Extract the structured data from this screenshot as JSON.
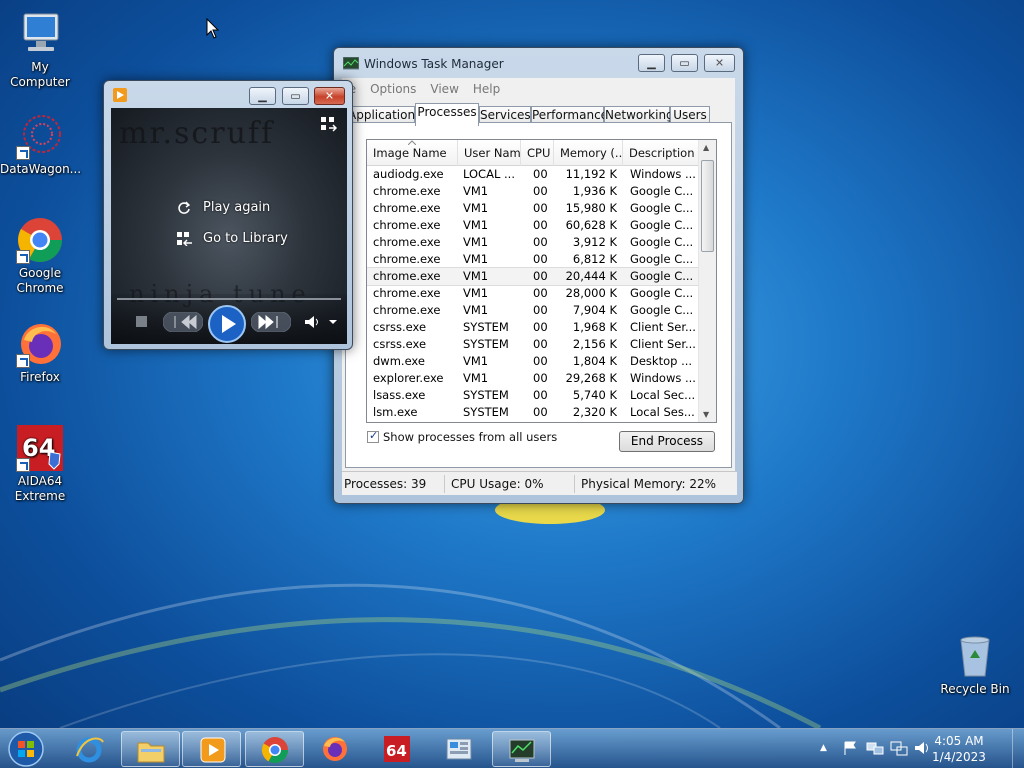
{
  "desktop": {
    "icons": [
      {
        "label": "My Computer"
      },
      {
        "label": "DataWagon..."
      },
      {
        "label": "Google Chrome"
      },
      {
        "label": "Firefox"
      },
      {
        "label": "AIDA64 Extreme"
      },
      {
        "label": "Recycle Bin"
      }
    ]
  },
  "media_player": {
    "play_again": "Play again",
    "go_to_library": "Go to Library",
    "art_title": "mr.scruff",
    "art_subtitle": "ninja tune"
  },
  "task_manager": {
    "title": "Windows Task Manager",
    "menu": [
      "File",
      "Options",
      "View",
      "Help"
    ],
    "tabs": [
      "Applications",
      "Processes",
      "Services",
      "Performance",
      "Networking",
      "Users"
    ],
    "active_tab": "Processes",
    "columns": [
      "Image Name",
      "User Name",
      "CPU",
      "Memory (...",
      "Description"
    ],
    "rows": [
      [
        "audiodg.exe",
        "LOCAL ...",
        "00",
        "11,192 K",
        "Windows ..."
      ],
      [
        "chrome.exe",
        "VM1",
        "00",
        "1,936 K",
        "Google C..."
      ],
      [
        "chrome.exe",
        "VM1",
        "00",
        "15,980 K",
        "Google C..."
      ],
      [
        "chrome.exe",
        "VM1",
        "00",
        "60,628 K",
        "Google C..."
      ],
      [
        "chrome.exe",
        "VM1",
        "00",
        "3,912 K",
        "Google C..."
      ],
      [
        "chrome.exe",
        "VM1",
        "00",
        "6,812 K",
        "Google C..."
      ],
      [
        "chrome.exe",
        "VM1",
        "00",
        "20,444 K",
        "Google C..."
      ],
      [
        "chrome.exe",
        "VM1",
        "00",
        "28,000 K",
        "Google C..."
      ],
      [
        "chrome.exe",
        "VM1",
        "00",
        "7,904 K",
        "Google C..."
      ],
      [
        "csrss.exe",
        "SYSTEM",
        "00",
        "1,968 K",
        "Client Ser..."
      ],
      [
        "csrss.exe",
        "SYSTEM",
        "00",
        "2,156 K",
        "Client Ser..."
      ],
      [
        "dwm.exe",
        "VM1",
        "00",
        "1,804 K",
        "Desktop ..."
      ],
      [
        "explorer.exe",
        "VM1",
        "00",
        "29,268 K",
        "Windows ..."
      ],
      [
        "lsass.exe",
        "SYSTEM",
        "00",
        "5,740 K",
        "Local Sec..."
      ],
      [
        "lsm.exe",
        "SYSTEM",
        "00",
        "2,320 K",
        "Local Ses..."
      ]
    ],
    "show_all_users": "Show processes from all users",
    "end_process": "End Process",
    "status": {
      "processes": "Processes: 39",
      "cpu": "CPU Usage: 0%",
      "memory": "Physical Memory: 22%"
    }
  },
  "taskbar": {
    "time": "4:05 AM",
    "date": "1/4/2023"
  },
  "colors": {
    "desktop_blue": "#1f79c9",
    "taskbar": "#3c6ea5",
    "close_red": "#c7422a"
  }
}
